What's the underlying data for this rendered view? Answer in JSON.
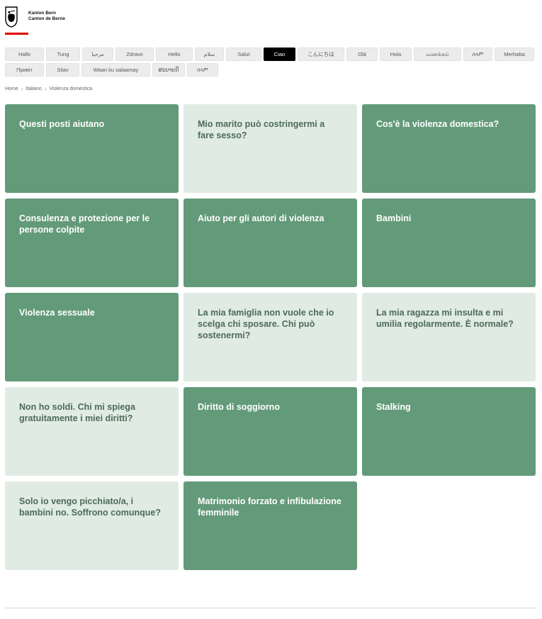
{
  "brand": {
    "line1": "Kanton Bern",
    "line2": "Canton de Berne"
  },
  "languages": [
    {
      "label": "Hallo",
      "w": 55
    },
    {
      "label": "Tung",
      "w": 48
    },
    {
      "label": "مرحبا",
      "w": 44
    },
    {
      "label": "Zdravo",
      "w": 54
    },
    {
      "label": "Hello",
      "w": 52
    },
    {
      "label": "سلام",
      "w": 41
    },
    {
      "label": "Salut",
      "w": 50
    },
    {
      "label": "Ciao",
      "w": 45,
      "active": true
    },
    {
      "label": "こんにちは",
      "w": 66
    },
    {
      "label": "Olá",
      "w": 44
    },
    {
      "label": "Hola",
      "w": 45
    },
    {
      "label": "வணக்கம்",
      "w": 67
    },
    {
      "label": "ሰላም",
      "w": 41
    },
    {
      "label": "Merhaba",
      "w": 56
    },
    {
      "label": "Привіт",
      "w": 55
    },
    {
      "label": "Silav",
      "w": 47
    },
    {
      "label": "Waan ku salaamay",
      "w": 97
    },
    {
      "label": "ສະບາຍດີ",
      "w": 46
    },
    {
      "label": "ሰላም",
      "w": 44
    }
  ],
  "breadcrumb": [
    "Home",
    "Italiano",
    "Violenza domestica"
  ],
  "cards": [
    {
      "title": "Questi posti aiutano",
      "style": "dark"
    },
    {
      "title": "Mio marito può costringermi a fare sesso?",
      "style": "light"
    },
    {
      "title": "Cos'è la violenza domestica?",
      "style": "dark"
    },
    {
      "title": "Consulenza e protezione per le persone colpite",
      "style": "dark"
    },
    {
      "title": "Aiuto per gli autori di violenza",
      "style": "dark"
    },
    {
      "title": "Bambini",
      "style": "dark"
    },
    {
      "title": "Violenza sessuale",
      "style": "dark"
    },
    {
      "title": "La mia famiglia non vuole che io scelga chi sposare. Chi può sostenermi?",
      "style": "light"
    },
    {
      "title": "La mia ragazza mi insulta e mi umilia regolarmente. È normale?",
      "style": "light"
    },
    {
      "title": "Non ho soldi. Chi mi spiega gratuitamente i miei diritti?",
      "style": "light"
    },
    {
      "title": "Diritto di soggiorno",
      "style": "dark"
    },
    {
      "title": "Stalking",
      "style": "dark"
    },
    {
      "title": "Solo io vengo picchiato/a, i bambini no. Soffrono comunque?",
      "style": "light"
    },
    {
      "title": "Matrimonio forzato e infibulazione femminile",
      "style": "dark"
    }
  ],
  "colors": {
    "card_dark": "#639a79",
    "card_light": "#e0ebe4",
    "accent_red": "#e10000"
  }
}
